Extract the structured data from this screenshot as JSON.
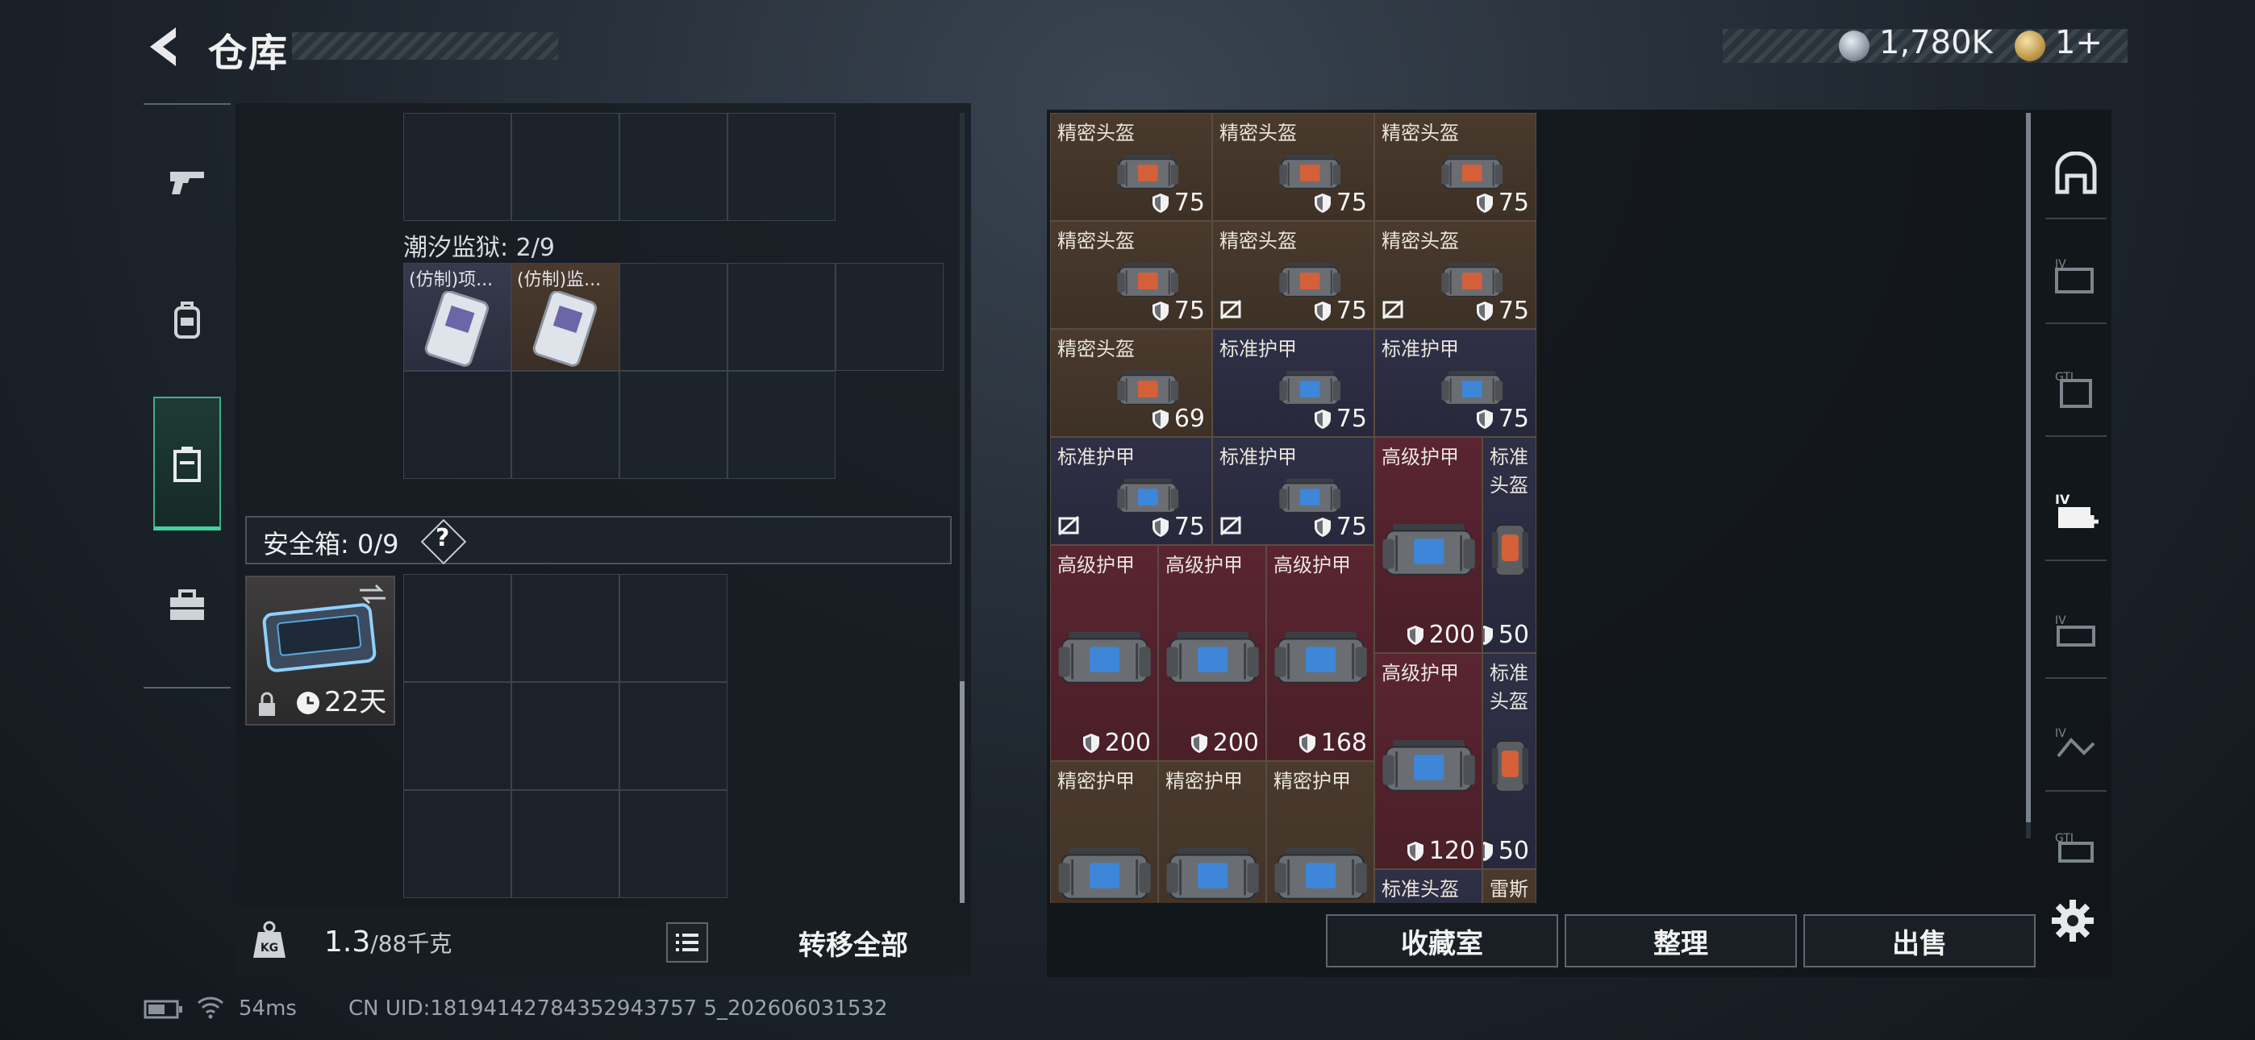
{
  "header": {
    "title": "仓库"
  },
  "currency": {
    "silver": "1,780K",
    "gold": "1+"
  },
  "left_panel": {
    "container_label": "潮汐监狱: 2/9",
    "container_items": [
      "(仿制)项...",
      "(仿制)监..."
    ],
    "safebox_label": "安全箱: 0/9",
    "safebox_help": "?",
    "safebox_timer": "22天",
    "weight_value": "1.3",
    "weight_max": "/88千克",
    "transfer_label": "转移全部"
  },
  "stash_items": [
    {
      "name": "精密头盔",
      "dur": "75"
    },
    {
      "name": "精密头盔",
      "dur": "75"
    },
    {
      "name": "精密头盔",
      "dur": "75"
    },
    {
      "name": "精密头盔",
      "dur": "75"
    },
    {
      "name": "精密头盔",
      "dur": "75"
    },
    {
      "name": "精密头盔",
      "dur": "75"
    },
    {
      "name": "精密头盔",
      "dur": "69"
    },
    {
      "name": "标准护甲",
      "dur": "75"
    },
    {
      "name": "标准护甲",
      "dur": "75"
    },
    {
      "name": "标准护甲",
      "dur": "75"
    },
    {
      "name": "标准护甲",
      "dur": "75"
    },
    {
      "name": "高级护甲",
      "dur": "200"
    },
    {
      "name": "标准头盔",
      "dur": "50"
    },
    {
      "name": "高级护甲",
      "dur": "200"
    },
    {
      "name": "高级护甲",
      "dur": "200"
    },
    {
      "name": "高级护甲",
      "dur": "168"
    },
    {
      "name": "高级护甲",
      "dur": "120"
    },
    {
      "name": "标准头盔",
      "dur": "50"
    },
    {
      "name": "精密护甲",
      "dur": ""
    },
    {
      "name": "精密护甲",
      "dur": ""
    },
    {
      "name": "精密护甲",
      "dur": ""
    },
    {
      "name": "标准头盔",
      "dur": ""
    },
    {
      "name": "雷斯舞步",
      "dur": ""
    }
  ],
  "bottom_buttons": {
    "collection": "收藏室",
    "organize": "整理",
    "sell": "出售"
  },
  "status_bar": {
    "ping": "54ms",
    "uid": "CN UID:18194142784352943757 5_202606031532"
  },
  "colors": {
    "accent": "#43d19f",
    "helmet_bg": "#4a3a2d",
    "standard_bg": "#2f3046",
    "advanced_bg": "#5a2530"
  }
}
